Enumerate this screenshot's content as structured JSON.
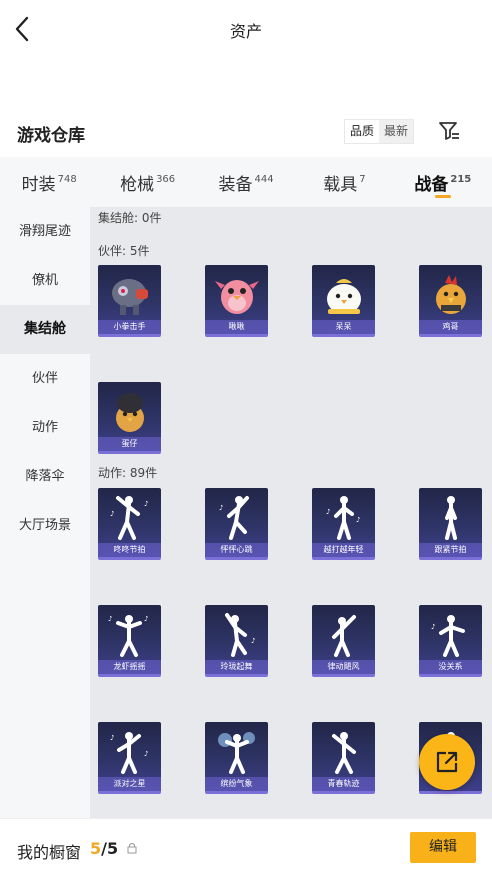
{
  "header": {
    "title": "资产",
    "back_icon": "chevron-left-icon"
  },
  "warehouse": {
    "title": "游戏仓库",
    "sort": {
      "options": [
        "品质",
        "最新"
      ],
      "selected": "品质"
    },
    "filter_icon": "filter-icon"
  },
  "tabs": [
    {
      "label": "时装",
      "count": "748",
      "active": false
    },
    {
      "label": "枪械",
      "count": "366",
      "active": false
    },
    {
      "label": "装备",
      "count": "444",
      "active": false
    },
    {
      "label": "载具",
      "count": "7",
      "active": false
    },
    {
      "label": "战备",
      "count": "215",
      "active": true
    }
  ],
  "sidebar": [
    {
      "label": "滑翔尾迹",
      "active": false
    },
    {
      "label": "僚机",
      "active": false
    },
    {
      "label": "集结舱",
      "active": true
    },
    {
      "label": "伙伴",
      "active": false
    },
    {
      "label": "动作",
      "active": false
    },
    {
      "label": "降落伞",
      "active": false
    },
    {
      "label": "大厅场景",
      "active": false
    }
  ],
  "groups": {
    "pod": {
      "label": "集结舱: 0件"
    },
    "companion": {
      "label": "伙伴: 5件",
      "items": [
        {
          "name": "小拳击手",
          "icon": "boxer-mech-icon"
        },
        {
          "name": "啾啾",
          "icon": "pink-bird-icon"
        },
        {
          "name": "呆呆",
          "icon": "white-chick-icon"
        },
        {
          "name": "鸡哥",
          "icon": "rooster-icon"
        },
        {
          "name": "蛋仔",
          "icon": "egg-bird-icon"
        }
      ]
    },
    "emote": {
      "label": "动作: 89件",
      "items": [
        {
          "name": "咚咚节拍",
          "icon": "dance-pose-icon"
        },
        {
          "name": "怦怦心跳",
          "icon": "dance-pose-icon"
        },
        {
          "name": "越打越年轻",
          "icon": "dance-pose-icon"
        },
        {
          "name": "跟紧节拍",
          "icon": "dance-pose-icon"
        },
        {
          "name": "龙虾摇摇",
          "icon": "dance-pose-icon"
        },
        {
          "name": "玲珑起舞",
          "icon": "dance-pose-icon"
        },
        {
          "name": "律动飓风",
          "icon": "dance-pose-icon"
        },
        {
          "name": "没关系",
          "icon": "dance-pose-icon"
        },
        {
          "name": "派对之星",
          "icon": "dance-pose-icon"
        },
        {
          "name": "缤纷气象",
          "icon": "dance-pose-icon"
        },
        {
          "name": "青春轨迹",
          "icon": "dance-pose-icon"
        }
      ]
    }
  },
  "showcase": {
    "label": "我的橱窗",
    "current": "5",
    "total": "/5",
    "lock_icon": "lock-icon"
  },
  "edit_label": "编辑",
  "share_icon": "share-external-icon",
  "colors": {
    "accent": "#f5a623",
    "card_top": "#222648",
    "card_bottom": "#3e3f8a",
    "card_caption": "#7b6fd8"
  }
}
